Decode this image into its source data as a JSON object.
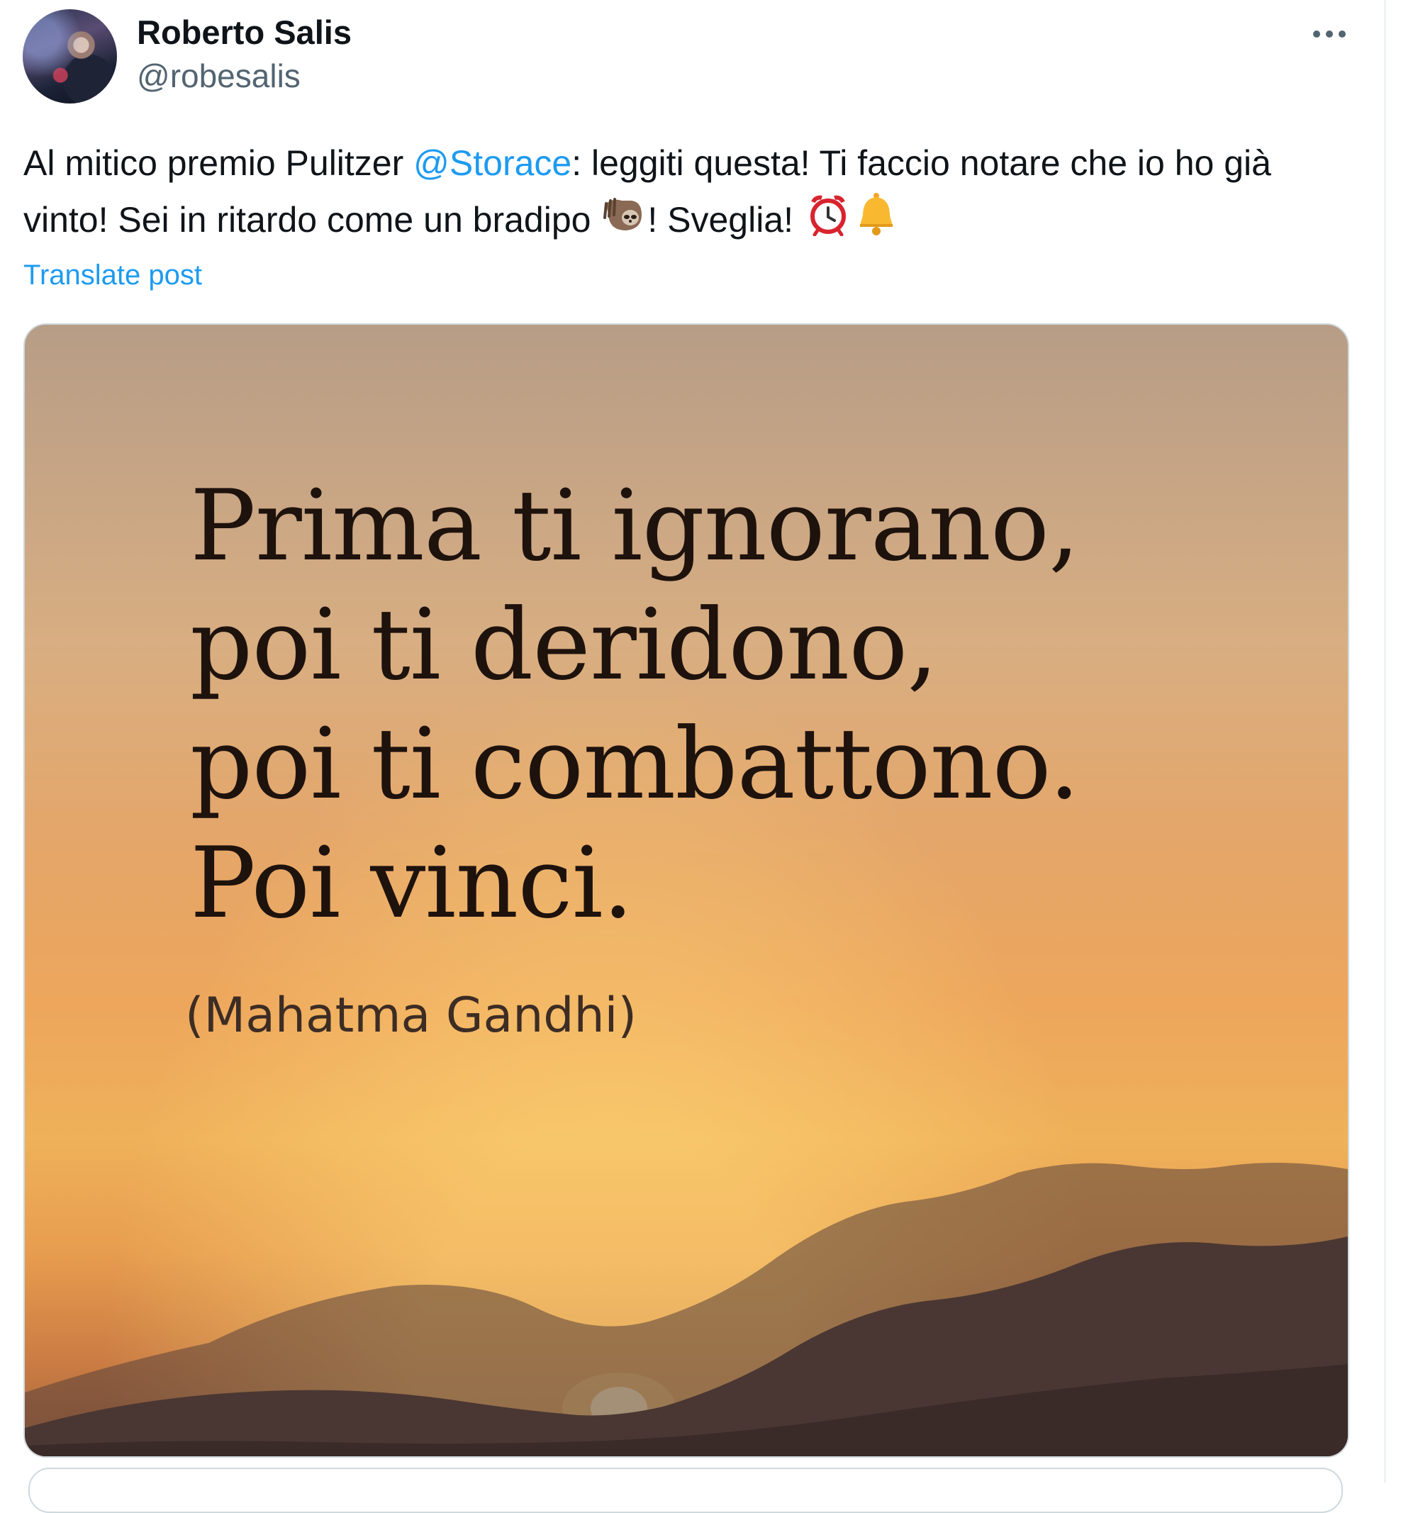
{
  "user": {
    "display_name": "Roberto Salis",
    "handle": "@robesalis"
  },
  "tweet": {
    "text_part1": "Al mitico premio Pulitzer ",
    "mention": "@Storace",
    "text_part2": ": leggiti questa! Ti faccio notare che io ho già vinto! Sei in ritardo come un bradipo ",
    "emoji_sloth": "sloth-emoji",
    "text_part3": "! Sveglia! ",
    "emoji_alarm": "alarm-clock-emoji",
    "emoji_bell": "bell-emoji",
    "translate_label": "Translate post"
  },
  "media": {
    "quote_lines": [
      "Prima ti ignorano,",
      "poi ti deridono,",
      "poi ti combattono.",
      "Poi vinci."
    ],
    "author": "(Mahatma Gandhi)"
  },
  "icons": {
    "more": "more-horizontal-icon"
  },
  "colors": {
    "link": "#1d9bf0",
    "text": "#0f1419",
    "secondary": "#536471",
    "border": "#cfd9de"
  }
}
